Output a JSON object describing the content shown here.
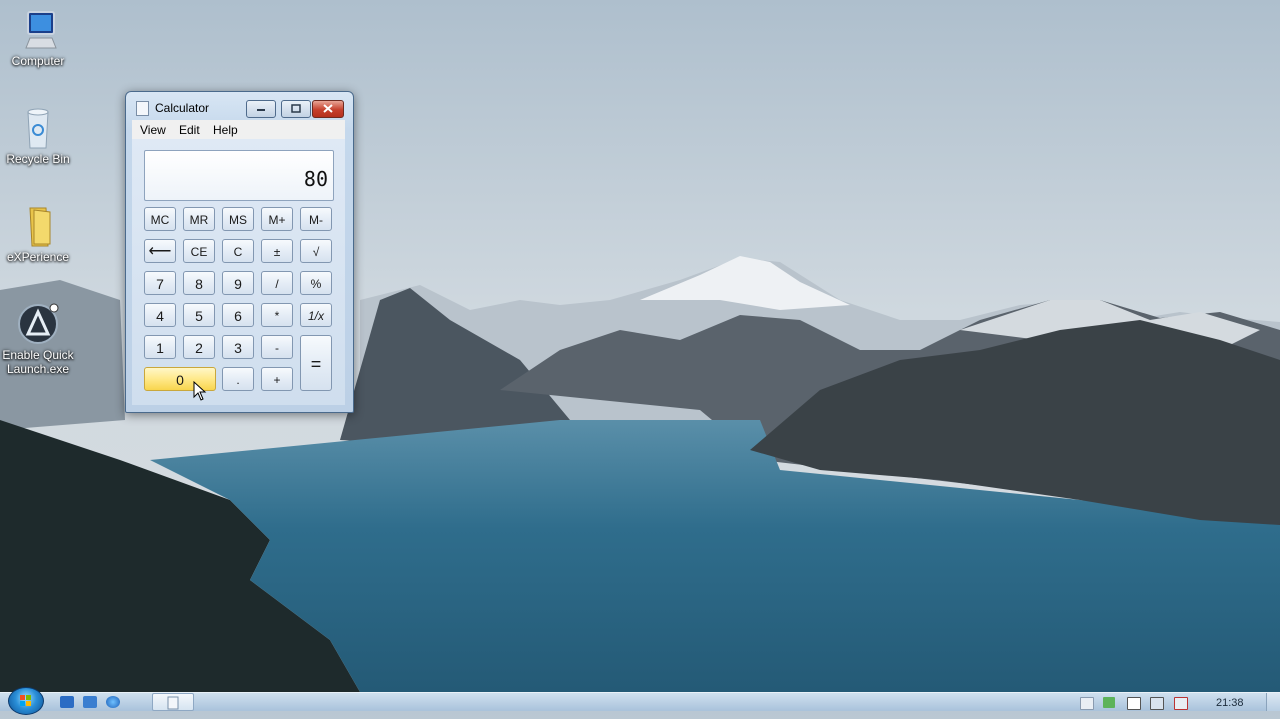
{
  "desktop": {
    "icons": [
      {
        "label": "Computer"
      },
      {
        "label": "Recycle Bin"
      },
      {
        "label": "eXPerience"
      },
      {
        "label": "Enable Quick Launch.exe"
      }
    ]
  },
  "calculator": {
    "title": "Calculator",
    "menu": [
      "View",
      "Edit",
      "Help"
    ],
    "display": "80",
    "memory_keys": [
      "MC",
      "MR",
      "MS",
      "M+",
      "M-"
    ],
    "row2": [
      "⟵",
      "CE",
      "C",
      "±",
      "√"
    ],
    "row3": [
      "7",
      "8",
      "9",
      "/",
      "%"
    ],
    "row4": [
      "4",
      "5",
      "6",
      "*",
      "1/x"
    ],
    "row5": [
      "1",
      "2",
      "3",
      "-"
    ],
    "row6": [
      "0",
      ".",
      "+"
    ],
    "equals": "="
  },
  "taskbar": {
    "clock": "21:38"
  },
  "colors": {
    "zero_key_highlight": "#ffe98a",
    "close_button": "#c6402d"
  }
}
